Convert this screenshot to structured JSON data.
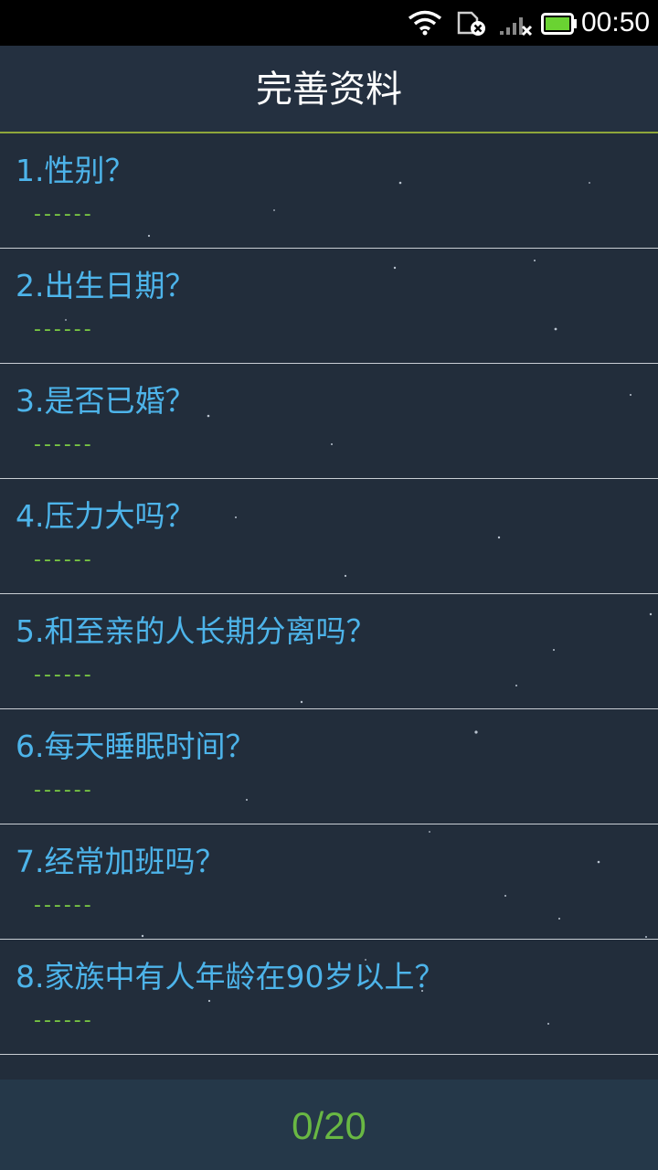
{
  "status_bar": {
    "time": "00:50",
    "icons": [
      "wifi-icon",
      "sim-card-error-icon",
      "cell-signal-no-service-icon",
      "battery-charging-icon"
    ]
  },
  "header": {
    "title": "完善资料"
  },
  "questions": [
    {
      "title": "1.性别？",
      "answer": "------"
    },
    {
      "title": "2.出生日期？",
      "answer": "------"
    },
    {
      "title": "3.是否已婚？",
      "answer": "------"
    },
    {
      "title": "4.压力大吗？",
      "answer": "------"
    },
    {
      "title": "5.和至亲的人长期分离吗？",
      "answer": "------"
    },
    {
      "title": "6.每天睡眠时间？",
      "answer": "------"
    },
    {
      "title": "7.经常加班吗？",
      "answer": "------"
    },
    {
      "title": "8.家族中有人年龄在90岁以上？",
      "answer": "------"
    }
  ],
  "footer": {
    "progress": "0/20"
  },
  "colors": {
    "background": "#222d3b",
    "question_text": "#4db4ea",
    "answer_text": "#7ac943",
    "header_divider": "#8fa63a",
    "footer_background": "#253849",
    "progress_text": "#69b843"
  }
}
